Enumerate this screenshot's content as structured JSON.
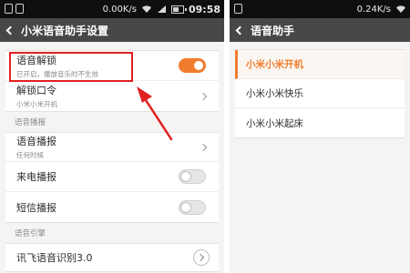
{
  "left": {
    "status": {
      "speed": "0.00K/s",
      "time": "09:58"
    },
    "title": "小米语音助手设置",
    "voice_unlock": {
      "title": "语音解锁",
      "subtitle": "已开启，播放音乐时不生效",
      "enabled": true
    },
    "unlock_command": {
      "title": "解锁口令",
      "subtitle": "小米小米开机"
    },
    "section_broadcast": "语音播报",
    "voice_broadcast": {
      "title": "语音播报",
      "subtitle": "任何时候"
    },
    "call_broadcast": {
      "title": "来电播报",
      "enabled": false
    },
    "sms_broadcast": {
      "title": "短信播报",
      "enabled": false
    },
    "section_engine": "语音引擎",
    "engine": {
      "title": "讯飞语音识别3.0"
    }
  },
  "right": {
    "status": {
      "speed": "0.24K/s"
    },
    "title": "语音助手",
    "commands": [
      {
        "label": "小米小米开机",
        "selected": true
      },
      {
        "label": "小米小米快乐",
        "selected": false
      },
      {
        "label": "小米小米起床",
        "selected": false
      }
    ]
  },
  "colors": {
    "accent": "#f07c2e",
    "annotation": "#e02020"
  }
}
